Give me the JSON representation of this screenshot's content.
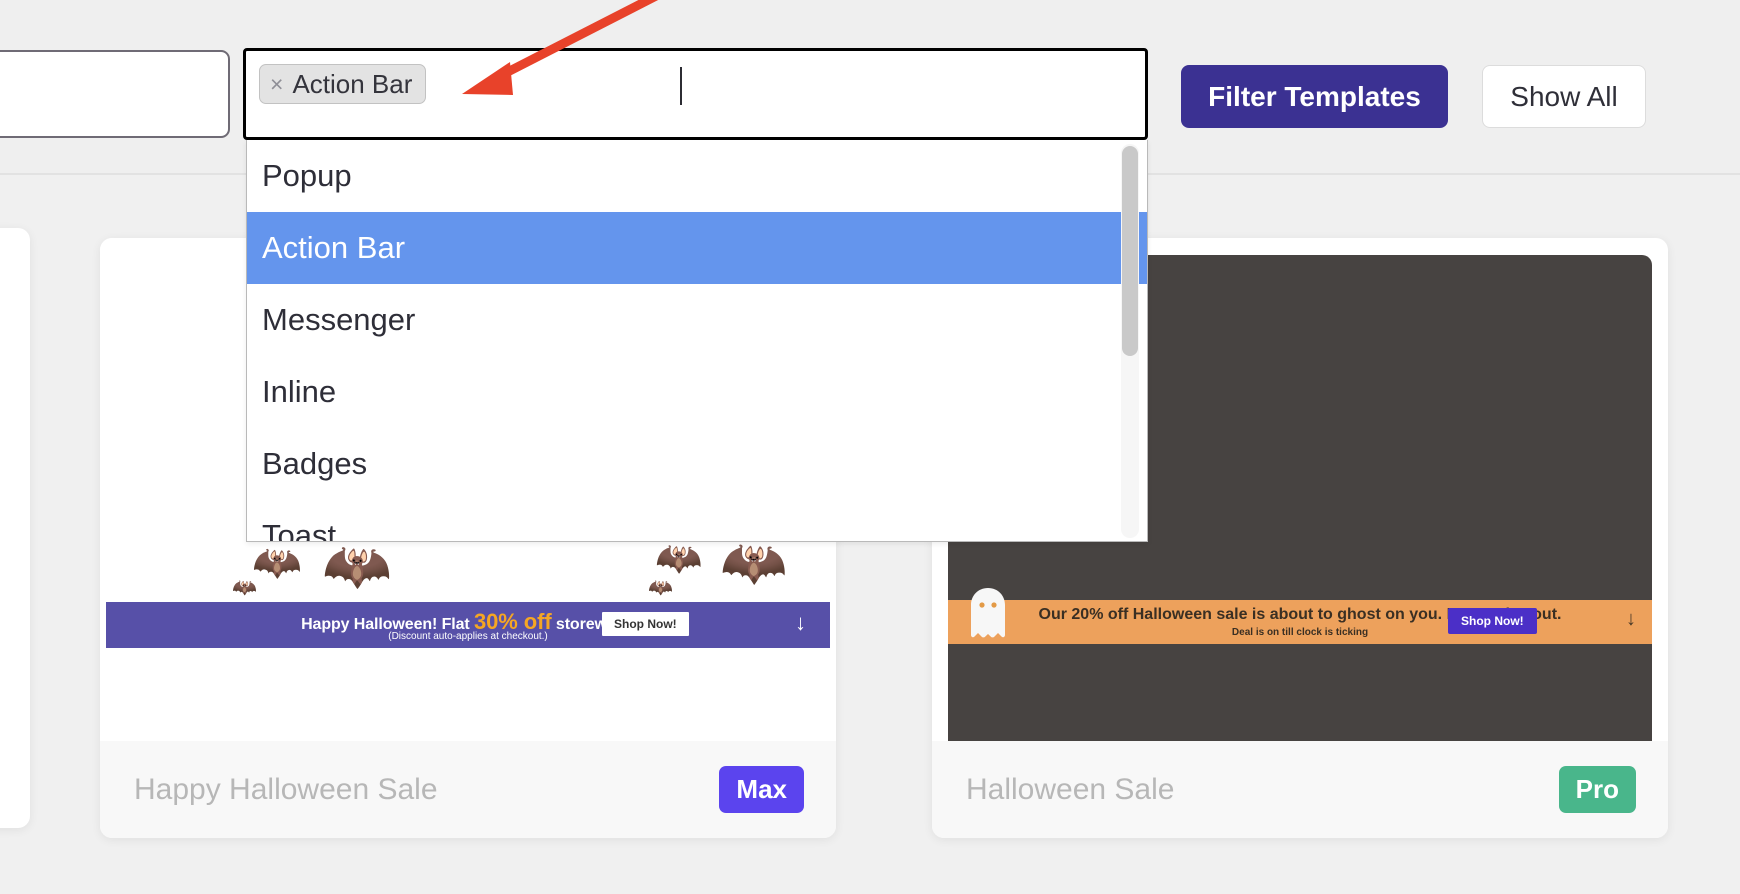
{
  "toolbar": {
    "filter_templates_label": "Filter Templates",
    "show_all_label": "Show All"
  },
  "multiselect": {
    "chip_label": "Action Bar",
    "chip_remove_icon": "close-x-icon",
    "placeholder": "",
    "value": ""
  },
  "dropdown": {
    "options": [
      {
        "label": "Popup",
        "selected": false
      },
      {
        "label": "Action Bar",
        "selected": true
      },
      {
        "label": "Messenger",
        "selected": false
      },
      {
        "label": "Inline",
        "selected": false
      },
      {
        "label": "Badges",
        "selected": false
      },
      {
        "label": "Toast",
        "selected": false
      }
    ]
  },
  "cards": [
    {
      "title": "Happy Halloween Sale",
      "badge": "Max",
      "badge_color": "#5b44ee",
      "banner": {
        "headline_pre": "Happy Halloween! Flat ",
        "headline_pct": "30% off",
        "headline_post": " storewide!",
        "subline": "(Discount auto-applies at checkout.)",
        "cta": "Shop Now!",
        "collapse_icon": "down-arrow-icon",
        "bg_color": "#5750a8"
      }
    },
    {
      "title": "Halloween Sale",
      "badge": "Pro",
      "badge_color": "#49b68b",
      "banner": {
        "headline": "Our 20% off Halloween sale is about to ghost on you. Don't miss out.",
        "subline": "Deal is on till clock is ticking",
        "cta": "Shop Now!",
        "collapse_icon": "down-arrow-icon",
        "bg_color": "#eda15c"
      }
    }
  ],
  "annotation": {
    "arrow_color": "#e8422a"
  }
}
